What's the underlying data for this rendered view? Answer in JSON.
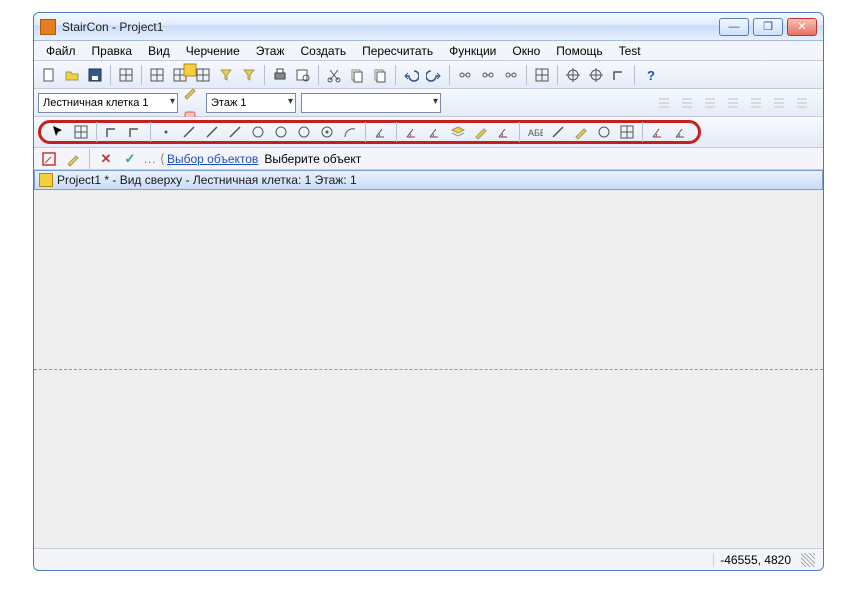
{
  "window": {
    "title": "StairCon - Project1"
  },
  "menu": [
    "Файл",
    "Правка",
    "Вид",
    "Черчение",
    "Этаж",
    "Создать",
    "Пересчитать",
    "Функции",
    "Окно",
    "Помощь",
    "Test"
  ],
  "toolbar1_icons": [
    "new",
    "open",
    "save",
    "props",
    "grid1",
    "grid2",
    "tree",
    "filter",
    "cone",
    "print",
    "preview",
    "cut",
    "copy",
    "paste",
    "undo",
    "redo",
    "link1",
    "link2",
    "link3",
    "box-link",
    "anchor",
    "crosshair",
    "corner",
    "help"
  ],
  "row2": {
    "stairwell_options_selected": "Лестничная клетка 1",
    "floor_selected": "Этаж 1",
    "empty_selected": "",
    "row2_icons_a": [
      "sel-yellow",
      "sel-pencil",
      "sel-eraser",
      "sel-highlight"
    ],
    "align_icons": [
      "align-left",
      "align-center",
      "align-right",
      "align-top",
      "distribute",
      "align-v",
      "guide"
    ]
  },
  "highlighted_toolbar_icons": [
    "pointer",
    "snap-grid",
    "corner-a",
    "corner-b",
    "dot1",
    "line1",
    "line2",
    "xline",
    "circle1",
    "circle2",
    "circle3",
    "target",
    "arc",
    "perp",
    "angle-a",
    "angle-b",
    "layers",
    "pencil",
    "angle-mark",
    "text-abv",
    "slash-a",
    "pencil2",
    "erase-circle",
    "box-angle",
    "zigzag",
    "measure"
  ],
  "statusrow": {
    "icons": [
      "edit-box",
      "edit-pencil",
      "sep",
      "red-x",
      "green-check",
      "arrow-left"
    ],
    "link_text": "Выбор объектов",
    "hint_text": "Выберите объект"
  },
  "document": {
    "title": "Project1 * - Вид сверху - Лестничная клетка: 1 Этаж: 1"
  },
  "statusbar": {
    "coords": "-46555,  4820"
  }
}
